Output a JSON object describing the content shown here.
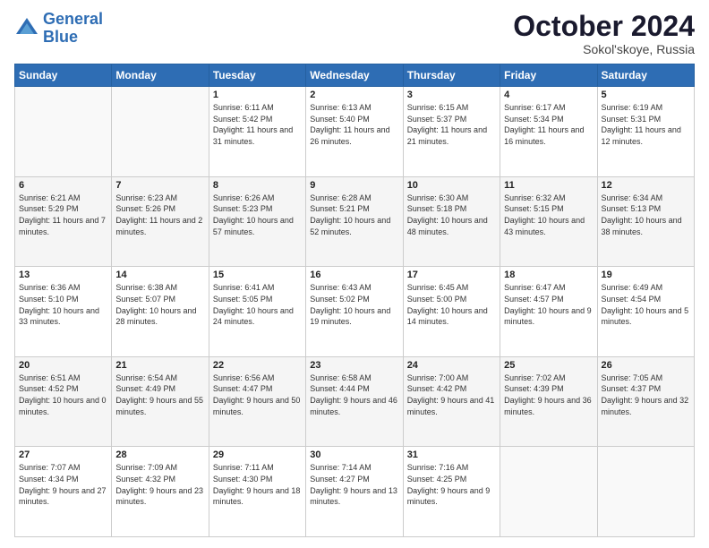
{
  "header": {
    "logo_line1": "General",
    "logo_line2": "Blue",
    "month": "October 2024",
    "location": "Sokol'skoye, Russia"
  },
  "weekdays": [
    "Sunday",
    "Monday",
    "Tuesday",
    "Wednesday",
    "Thursday",
    "Friday",
    "Saturday"
  ],
  "weeks": [
    [
      {
        "day": "",
        "sunrise": "",
        "sunset": "",
        "daylight": ""
      },
      {
        "day": "",
        "sunrise": "",
        "sunset": "",
        "daylight": ""
      },
      {
        "day": "1",
        "sunrise": "Sunrise: 6:11 AM",
        "sunset": "Sunset: 5:42 PM",
        "daylight": "Daylight: 11 hours and 31 minutes."
      },
      {
        "day": "2",
        "sunrise": "Sunrise: 6:13 AM",
        "sunset": "Sunset: 5:40 PM",
        "daylight": "Daylight: 11 hours and 26 minutes."
      },
      {
        "day": "3",
        "sunrise": "Sunrise: 6:15 AM",
        "sunset": "Sunset: 5:37 PM",
        "daylight": "Daylight: 11 hours and 21 minutes."
      },
      {
        "day": "4",
        "sunrise": "Sunrise: 6:17 AM",
        "sunset": "Sunset: 5:34 PM",
        "daylight": "Daylight: 11 hours and 16 minutes."
      },
      {
        "day": "5",
        "sunrise": "Sunrise: 6:19 AM",
        "sunset": "Sunset: 5:31 PM",
        "daylight": "Daylight: 11 hours and 12 minutes."
      }
    ],
    [
      {
        "day": "6",
        "sunrise": "Sunrise: 6:21 AM",
        "sunset": "Sunset: 5:29 PM",
        "daylight": "Daylight: 11 hours and 7 minutes."
      },
      {
        "day": "7",
        "sunrise": "Sunrise: 6:23 AM",
        "sunset": "Sunset: 5:26 PM",
        "daylight": "Daylight: 11 hours and 2 minutes."
      },
      {
        "day": "8",
        "sunrise": "Sunrise: 6:26 AM",
        "sunset": "Sunset: 5:23 PM",
        "daylight": "Daylight: 10 hours and 57 minutes."
      },
      {
        "day": "9",
        "sunrise": "Sunrise: 6:28 AM",
        "sunset": "Sunset: 5:21 PM",
        "daylight": "Daylight: 10 hours and 52 minutes."
      },
      {
        "day": "10",
        "sunrise": "Sunrise: 6:30 AM",
        "sunset": "Sunset: 5:18 PM",
        "daylight": "Daylight: 10 hours and 48 minutes."
      },
      {
        "day": "11",
        "sunrise": "Sunrise: 6:32 AM",
        "sunset": "Sunset: 5:15 PM",
        "daylight": "Daylight: 10 hours and 43 minutes."
      },
      {
        "day": "12",
        "sunrise": "Sunrise: 6:34 AM",
        "sunset": "Sunset: 5:13 PM",
        "daylight": "Daylight: 10 hours and 38 minutes."
      }
    ],
    [
      {
        "day": "13",
        "sunrise": "Sunrise: 6:36 AM",
        "sunset": "Sunset: 5:10 PM",
        "daylight": "Daylight: 10 hours and 33 minutes."
      },
      {
        "day": "14",
        "sunrise": "Sunrise: 6:38 AM",
        "sunset": "Sunset: 5:07 PM",
        "daylight": "Daylight: 10 hours and 28 minutes."
      },
      {
        "day": "15",
        "sunrise": "Sunrise: 6:41 AM",
        "sunset": "Sunset: 5:05 PM",
        "daylight": "Daylight: 10 hours and 24 minutes."
      },
      {
        "day": "16",
        "sunrise": "Sunrise: 6:43 AM",
        "sunset": "Sunset: 5:02 PM",
        "daylight": "Daylight: 10 hours and 19 minutes."
      },
      {
        "day": "17",
        "sunrise": "Sunrise: 6:45 AM",
        "sunset": "Sunset: 5:00 PM",
        "daylight": "Daylight: 10 hours and 14 minutes."
      },
      {
        "day": "18",
        "sunrise": "Sunrise: 6:47 AM",
        "sunset": "Sunset: 4:57 PM",
        "daylight": "Daylight: 10 hours and 9 minutes."
      },
      {
        "day": "19",
        "sunrise": "Sunrise: 6:49 AM",
        "sunset": "Sunset: 4:54 PM",
        "daylight": "Daylight: 10 hours and 5 minutes."
      }
    ],
    [
      {
        "day": "20",
        "sunrise": "Sunrise: 6:51 AM",
        "sunset": "Sunset: 4:52 PM",
        "daylight": "Daylight: 10 hours and 0 minutes."
      },
      {
        "day": "21",
        "sunrise": "Sunrise: 6:54 AM",
        "sunset": "Sunset: 4:49 PM",
        "daylight": "Daylight: 9 hours and 55 minutes."
      },
      {
        "day": "22",
        "sunrise": "Sunrise: 6:56 AM",
        "sunset": "Sunset: 4:47 PM",
        "daylight": "Daylight: 9 hours and 50 minutes."
      },
      {
        "day": "23",
        "sunrise": "Sunrise: 6:58 AM",
        "sunset": "Sunset: 4:44 PM",
        "daylight": "Daylight: 9 hours and 46 minutes."
      },
      {
        "day": "24",
        "sunrise": "Sunrise: 7:00 AM",
        "sunset": "Sunset: 4:42 PM",
        "daylight": "Daylight: 9 hours and 41 minutes."
      },
      {
        "day": "25",
        "sunrise": "Sunrise: 7:02 AM",
        "sunset": "Sunset: 4:39 PM",
        "daylight": "Daylight: 9 hours and 36 minutes."
      },
      {
        "day": "26",
        "sunrise": "Sunrise: 7:05 AM",
        "sunset": "Sunset: 4:37 PM",
        "daylight": "Daylight: 9 hours and 32 minutes."
      }
    ],
    [
      {
        "day": "27",
        "sunrise": "Sunrise: 7:07 AM",
        "sunset": "Sunset: 4:34 PM",
        "daylight": "Daylight: 9 hours and 27 minutes."
      },
      {
        "day": "28",
        "sunrise": "Sunrise: 7:09 AM",
        "sunset": "Sunset: 4:32 PM",
        "daylight": "Daylight: 9 hours and 23 minutes."
      },
      {
        "day": "29",
        "sunrise": "Sunrise: 7:11 AM",
        "sunset": "Sunset: 4:30 PM",
        "daylight": "Daylight: 9 hours and 18 minutes."
      },
      {
        "day": "30",
        "sunrise": "Sunrise: 7:14 AM",
        "sunset": "Sunset: 4:27 PM",
        "daylight": "Daylight: 9 hours and 13 minutes."
      },
      {
        "day": "31",
        "sunrise": "Sunrise: 7:16 AM",
        "sunset": "Sunset: 4:25 PM",
        "daylight": "Daylight: 9 hours and 9 minutes."
      },
      {
        "day": "",
        "sunrise": "",
        "sunset": "",
        "daylight": ""
      },
      {
        "day": "",
        "sunrise": "",
        "sunset": "",
        "daylight": ""
      }
    ]
  ]
}
